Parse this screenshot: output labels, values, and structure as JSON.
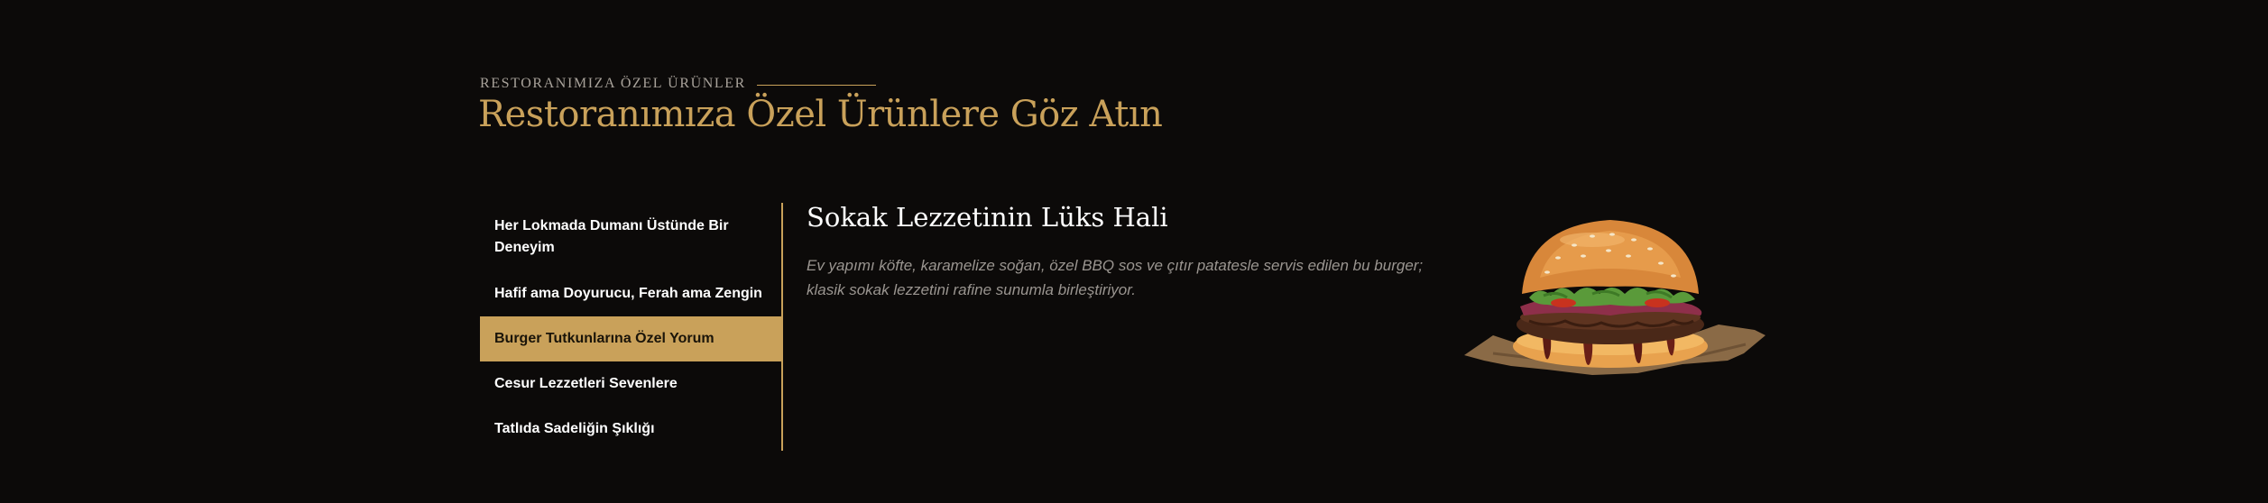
{
  "section": {
    "kicker": "RESTORANIMIZA ÖZEL ÜRÜNLER",
    "title": "Restoranımıza Özel Ürünlere Göz Atın"
  },
  "tabs": [
    {
      "label": "Her Lokmada Dumanı Üstünde Bir Deneyim",
      "active": false
    },
    {
      "label": "Hafif ama Doyurucu, Ferah ama Zengin",
      "active": false
    },
    {
      "label": "Burger Tutkunlarına Özel Yorum",
      "active": true
    },
    {
      "label": "Cesur Lezzetleri Sevenlere",
      "active": false
    },
    {
      "label": "Tatlıda Sadeliğin Şıklığı",
      "active": false
    }
  ],
  "content": {
    "title": "Sokak Lezzetinin Lüks Hali",
    "description": "Ev yapımı köfte, karamelize soğan, özel BBQ sos ve çıtır patatesle servis edilen bu burger; klasik sokak lezzetini rafine sunumla birleştiriyor."
  },
  "colors": {
    "background": "#0c0a09",
    "accent": "#c9a15a",
    "text": "#ffffff",
    "muted": "#9a9590"
  }
}
